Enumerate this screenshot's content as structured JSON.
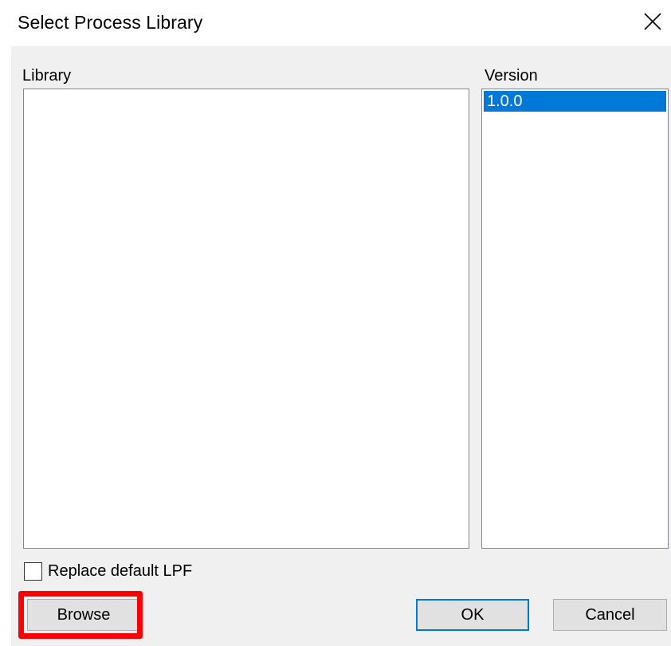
{
  "window": {
    "title": "Select Process Library",
    "close_icon": "close-icon"
  },
  "library": {
    "label": "Library",
    "items": []
  },
  "version": {
    "label": "Version",
    "items": [
      {
        "text": "1.0.0",
        "selected": true
      }
    ]
  },
  "replace_default": {
    "label": "Replace default LPF",
    "checked": false
  },
  "buttons": {
    "browse": "Browse",
    "ok": "OK",
    "cancel": "Cancel"
  },
  "colors": {
    "selection": "#0078d7",
    "highlight": "#ff0000",
    "panel": "#f0f0f0"
  }
}
